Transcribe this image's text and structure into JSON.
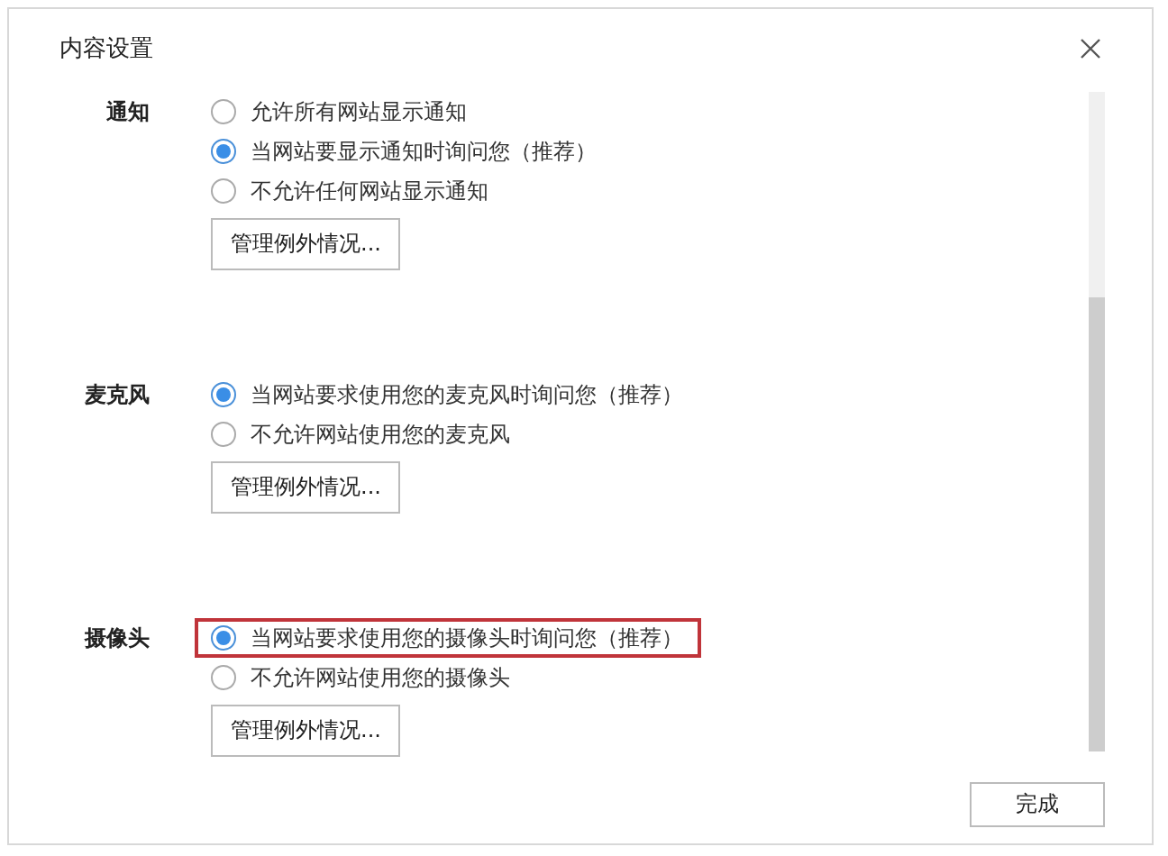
{
  "dialog": {
    "title": "内容设置"
  },
  "sections": [
    {
      "label": "通知",
      "options": [
        {
          "text": "允许所有网站显示通知",
          "selected": false,
          "highlighted": false
        },
        {
          "text": "当网站要显示通知时询问您（推荐）",
          "selected": true,
          "highlighted": false
        },
        {
          "text": "不允许任何网站显示通知",
          "selected": false,
          "highlighted": false
        }
      ],
      "button": "管理例外情况..."
    },
    {
      "label": "麦克风",
      "options": [
        {
          "text": "当网站要求使用您的麦克风时询问您（推荐）",
          "selected": true,
          "highlighted": false
        },
        {
          "text": "不允许网站使用您的麦克风",
          "selected": false,
          "highlighted": false
        }
      ],
      "button": "管理例外情况..."
    },
    {
      "label": "摄像头",
      "options": [
        {
          "text": "当网站要求使用您的摄像头时询问您（推荐）",
          "selected": true,
          "highlighted": true
        },
        {
          "text": "不允许网站使用您的摄像头",
          "selected": false,
          "highlighted": false
        }
      ],
      "button": "管理例外情况..."
    }
  ],
  "footer": {
    "done_button": "完成"
  }
}
